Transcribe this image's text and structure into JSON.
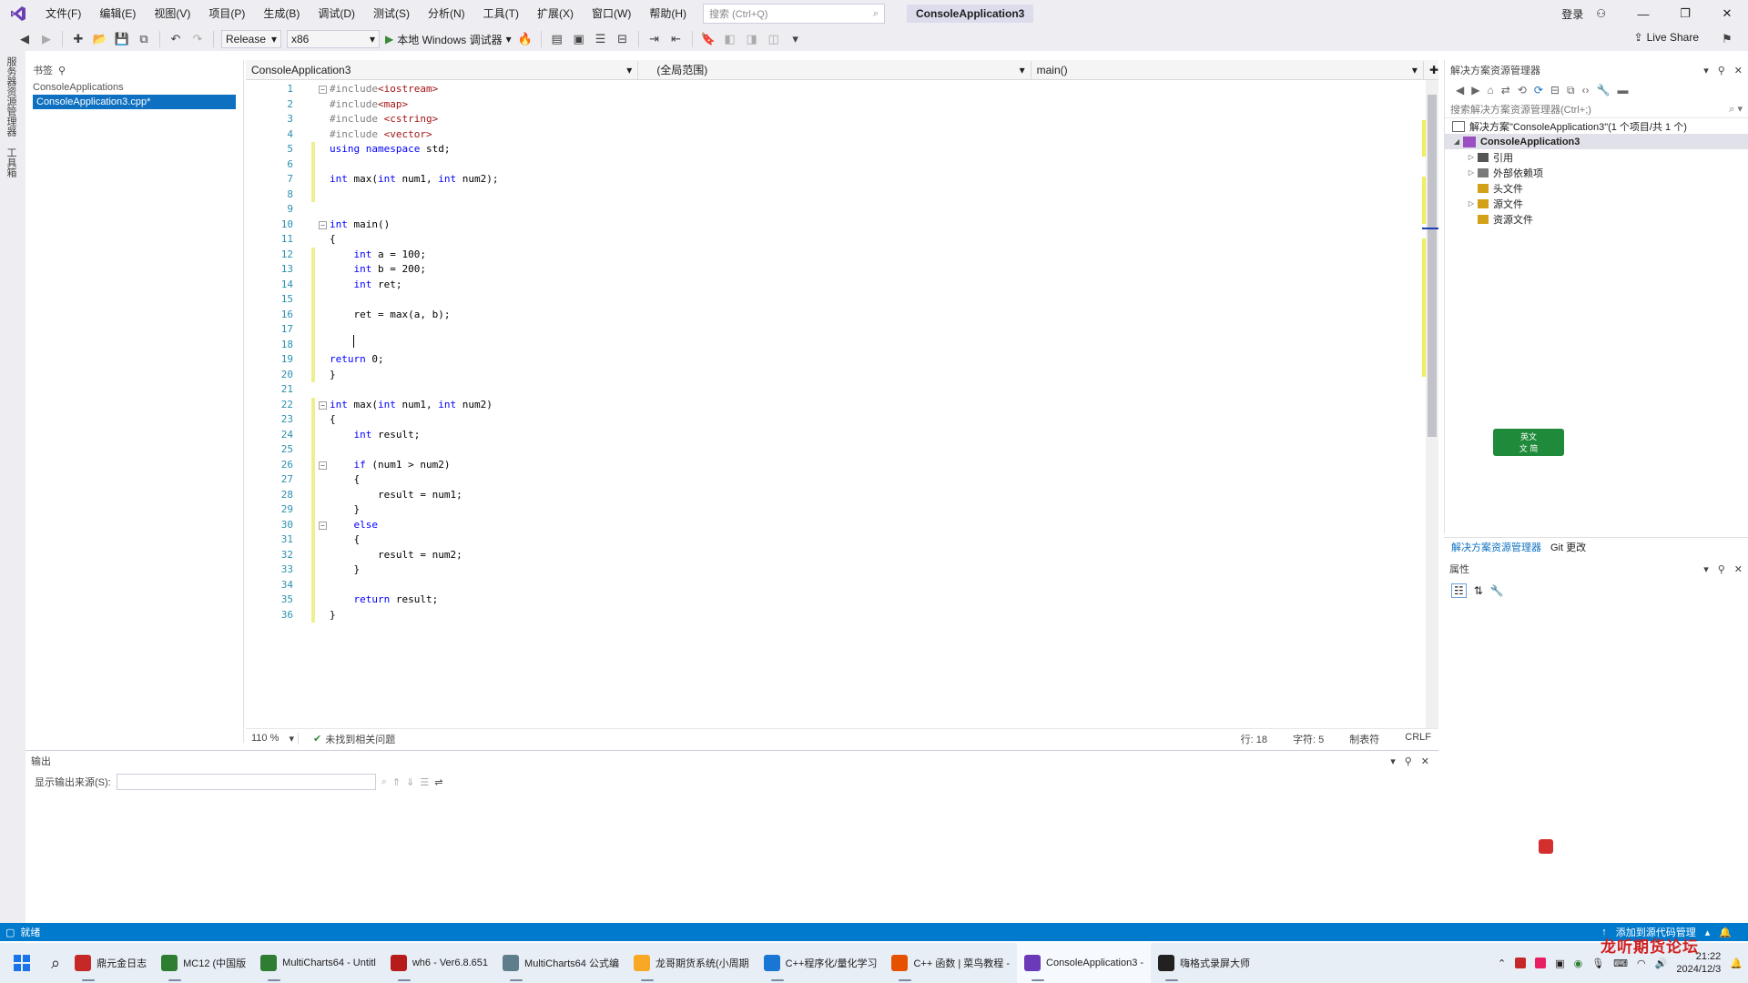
{
  "menubar": {
    "items": [
      "文件(F)",
      "编辑(E)",
      "视图(V)",
      "项目(P)",
      "生成(B)",
      "调试(D)",
      "测试(S)",
      "分析(N)",
      "工具(T)",
      "扩展(X)",
      "窗口(W)",
      "帮助(H)"
    ],
    "search_placeholder": "搜索 (Ctrl+Q)",
    "solution_title": "ConsoleApplication3",
    "signin": "登录"
  },
  "toolbar": {
    "config": "Release",
    "platform": "x86",
    "run_label": "本地 Windows 调试器",
    "live_share": "Live Share"
  },
  "left_rail": {
    "tabs": [
      "服务器资源管理器",
      "工具箱"
    ]
  },
  "left_panel": {
    "title": "书签",
    "items": [
      "ConsoleApplications",
      "ConsoleApplication3.cpp*"
    ]
  },
  "editor_nav": {
    "project": "ConsoleApplication3",
    "scope": "(全局范围)",
    "member": "main()"
  },
  "code": [
    {
      "n": "1",
      "fold": "-",
      "html": "<span class='pp'>#include</span><span class='str'>&lt;iostream&gt;</span>"
    },
    {
      "n": "2",
      "fold": "",
      "html": "<span class='pp'>#include</span><span class='str'>&lt;map&gt;</span>"
    },
    {
      "n": "3",
      "fold": "",
      "html": "<span class='pp'>#include</span> <span class='str'>&lt;cstring&gt;</span>"
    },
    {
      "n": "4",
      "fold": "",
      "html": "<span class='pp'>#include</span> <span class='str'>&lt;vector&gt;</span>"
    },
    {
      "n": "5",
      "fold": "",
      "html": "<span class='kw'>using namespace</span> std;"
    },
    {
      "n": "6",
      "fold": "",
      "html": ""
    },
    {
      "n": "7",
      "fold": "",
      "html": "<span class='kw'>int</span> max(<span class='kw'>int</span> num1, <span class='kw'>int</span> num2);"
    },
    {
      "n": "8",
      "fold": "",
      "html": ""
    },
    {
      "n": "9",
      "fold": "",
      "html": ""
    },
    {
      "n": "10",
      "fold": "-",
      "html": "<span class='kw'>int</span> main()"
    },
    {
      "n": "11",
      "fold": "",
      "html": "{"
    },
    {
      "n": "12",
      "fold": "",
      "html": "    <span class='kw'>int</span> a = 100;"
    },
    {
      "n": "13",
      "fold": "",
      "html": "    <span class='kw'>int</span> b = 200;"
    },
    {
      "n": "14",
      "fold": "",
      "html": "    <span class='kw'>int</span> ret;"
    },
    {
      "n": "15",
      "fold": "",
      "html": ""
    },
    {
      "n": "16",
      "fold": "",
      "html": "    ret = max(a, b);"
    },
    {
      "n": "17",
      "fold": "",
      "html": ""
    },
    {
      "n": "18",
      "fold": "",
      "html": ""
    },
    {
      "n": "19",
      "fold": "",
      "html": "<span class='kw'>return</span> 0;"
    },
    {
      "n": "20",
      "fold": "",
      "html": "}"
    },
    {
      "n": "21",
      "fold": "",
      "html": ""
    },
    {
      "n": "22",
      "fold": "-",
      "html": "<span class='kw'>int</span> max(<span class='kw'>int</span> num1, <span class='kw'>int</span> num2)"
    },
    {
      "n": "23",
      "fold": "",
      "html": "{"
    },
    {
      "n": "24",
      "fold": "",
      "html": "    <span class='kw'>int</span> result;"
    },
    {
      "n": "25",
      "fold": "",
      "html": ""
    },
    {
      "n": "26",
      "fold": "-",
      "html": "    <span class='kw'>if</span> (num1 &gt; num2)"
    },
    {
      "n": "27",
      "fold": "",
      "html": "    {"
    },
    {
      "n": "28",
      "fold": "",
      "html": "        result = num1;"
    },
    {
      "n": "29",
      "fold": "",
      "html": "    }"
    },
    {
      "n": "30",
      "fold": "-",
      "html": "    <span class='kw'>else</span>"
    },
    {
      "n": "31",
      "fold": "",
      "html": "    {"
    },
    {
      "n": "32",
      "fold": "",
      "html": "        result = num2;"
    },
    {
      "n": "33",
      "fold": "",
      "html": "    }"
    },
    {
      "n": "34",
      "fold": "",
      "html": ""
    },
    {
      "n": "35",
      "fold": "",
      "html": "    <span class='kw'>return</span> result;"
    },
    {
      "n": "36",
      "fold": "",
      "html": "}"
    }
  ],
  "editor_status": {
    "zoom": "110 %",
    "issues": "未找到相关问题",
    "line": "行: 18",
    "col": "字符: 5",
    "mode": "制表符",
    "eol": "CRLF"
  },
  "output": {
    "title": "输出",
    "source_label": "显示输出来源(S):"
  },
  "solution_explorer": {
    "title": "解决方案资源管理器",
    "search_placeholder": "搜索解决方案资源管理器(Ctrl+;)",
    "solution_row": "解决方案\"ConsoleApplication3\"(1 个项目/共 1 个)",
    "project": "ConsoleApplication3",
    "nodes": [
      {
        "label": "引用",
        "expandable": true
      },
      {
        "label": "外部依赖项",
        "expandable": true
      },
      {
        "label": "头文件",
        "expandable": false
      },
      {
        "label": "源文件",
        "expandable": true
      },
      {
        "label": "资源文件",
        "expandable": false
      }
    ],
    "tabs": [
      "解决方案资源管理器",
      "Git 更改"
    ]
  },
  "properties": {
    "title": "属性"
  },
  "ime_widget": {
    "line1": "英文",
    "line2": "文 简"
  },
  "statusbar": {
    "ready": "就绪",
    "source_control": "添加到源代码管理"
  },
  "taskbar": {
    "items": [
      {
        "label": "鼎元金日志",
        "color": "#c62828"
      },
      {
        "label": "MC12 (中国版",
        "color": "#2e7d32"
      },
      {
        "label": "MultiCharts64 - Untitl",
        "color": "#2e7d32"
      },
      {
        "label": "wh6 - Ver6.8.651",
        "color": "#b71c1c"
      },
      {
        "label": "MultiCharts64 公式编",
        "color": "#607d8b"
      },
      {
        "label": "龙哥期货系统(小周期",
        "color": "#f9a825"
      },
      {
        "label": "C++程序化/量化学习",
        "color": "#1976d2"
      },
      {
        "label": "C++ 函数 | 菜鸟教程 -",
        "color": "#e65100"
      },
      {
        "label": "ConsoleApplication3 -",
        "color": "#6a3ab8"
      },
      {
        "label": "嗨格式录屏大师",
        "color": "#212121"
      }
    ],
    "time": "21:22",
    "date": "2024/12/3"
  },
  "watermark": "龙听期货论坛",
  "colors": {
    "accent": "#007acc",
    "keyword": "#0000ff",
    "string": "#a31515",
    "preprocessor": "#808080",
    "line_number": "#2b91af",
    "change_margin": "#efef90"
  }
}
